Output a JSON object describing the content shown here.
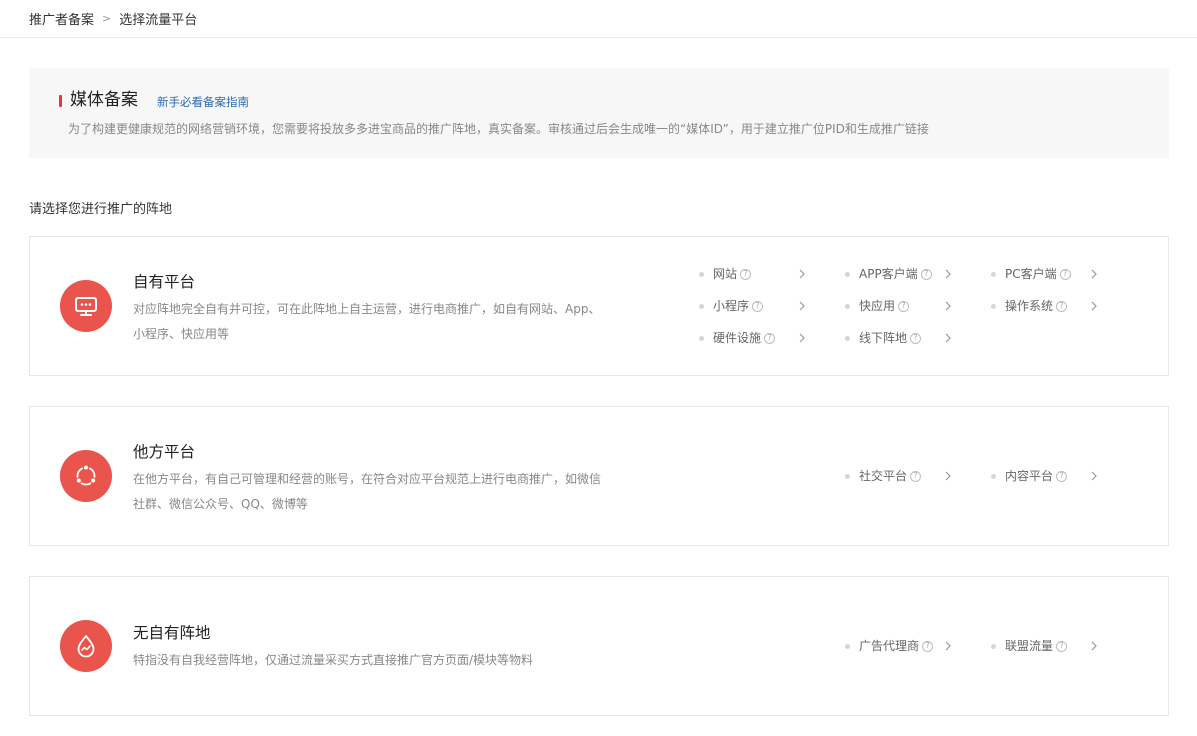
{
  "breadcrumb": {
    "parent": "推广者备案",
    "current": "选择流量平台"
  },
  "intro": {
    "title": "媒体备案",
    "guide_link": "新手必看备案指南",
    "description": "为了构建更健康规范的网络营销环境，您需要将投放多多进宝商品的推广阵地，真实备案。审核通过后会生成唯一的“媒体ID”，用于建立推广位PID和生成推广链接"
  },
  "section_label": "请选择您进行推广的阵地",
  "colors": {
    "accent": "#e9544d",
    "link": "#2d6bb5"
  },
  "cards": [
    {
      "name": "自有平台",
      "icon": "monitor-icon",
      "desc_line1": "对应阵地完全自有并可控，可在此阵地上自主运营，进行电商推广，如自有网站、App、",
      "desc_line2": "小程序、快应用等",
      "options": [
        {
          "label": "网站"
        },
        {
          "label": "APP客户端"
        },
        {
          "label": "PC客户端"
        },
        {
          "label": "小程序"
        },
        {
          "label": "快应用"
        },
        {
          "label": "操作系统"
        },
        {
          "label": "硬件设施"
        },
        {
          "label": "线下阵地"
        }
      ]
    },
    {
      "name": "他方平台",
      "icon": "network-icon",
      "desc_line1": "在他方平台，有自己可管理和经营的账号，在符合对应平台规范上进行电商推广，如微信",
      "desc_line2": "社群、微信公众号、QQ、微博等",
      "options": [
        {
          "label": "社交平台"
        },
        {
          "label": "内容平台"
        }
      ]
    },
    {
      "name": "无自有阵地",
      "icon": "drop-trend-icon",
      "desc_line1": "特指没有自我经营阵地，仅通过流量采买方式直接推广官方页面/模块等物料",
      "options": [
        {
          "label": "广告代理商"
        },
        {
          "label": "联盟流量"
        }
      ]
    }
  ]
}
